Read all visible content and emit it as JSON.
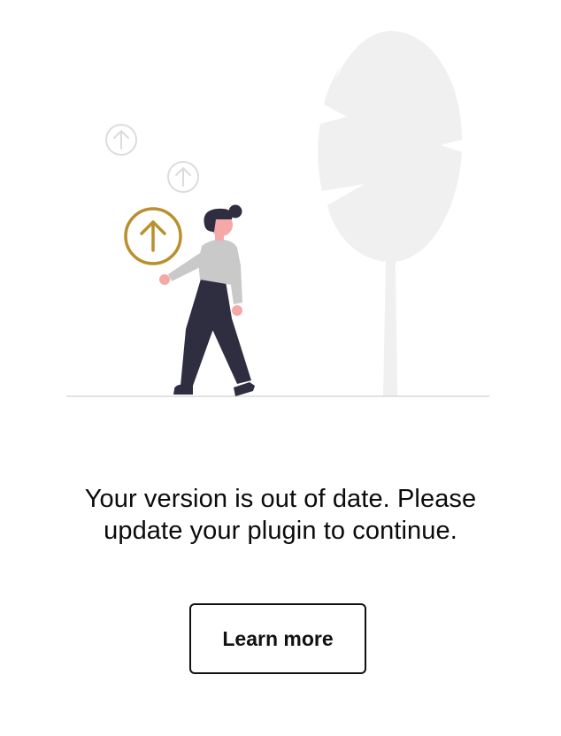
{
  "message": {
    "line1": "Your version is out of date. Please",
    "line2": "update your plugin to continue."
  },
  "cta": {
    "label": "Learn more"
  },
  "illustration": {
    "accent_color": "#b8902e",
    "faded_icon_color": "#dcdcdc",
    "tree_color": "#f0f0f0",
    "dark_color": "#2f2e41",
    "icons": [
      "arrow-up-circle-icon",
      "arrow-up-circle-icon",
      "arrow-up-circle-icon"
    ]
  }
}
